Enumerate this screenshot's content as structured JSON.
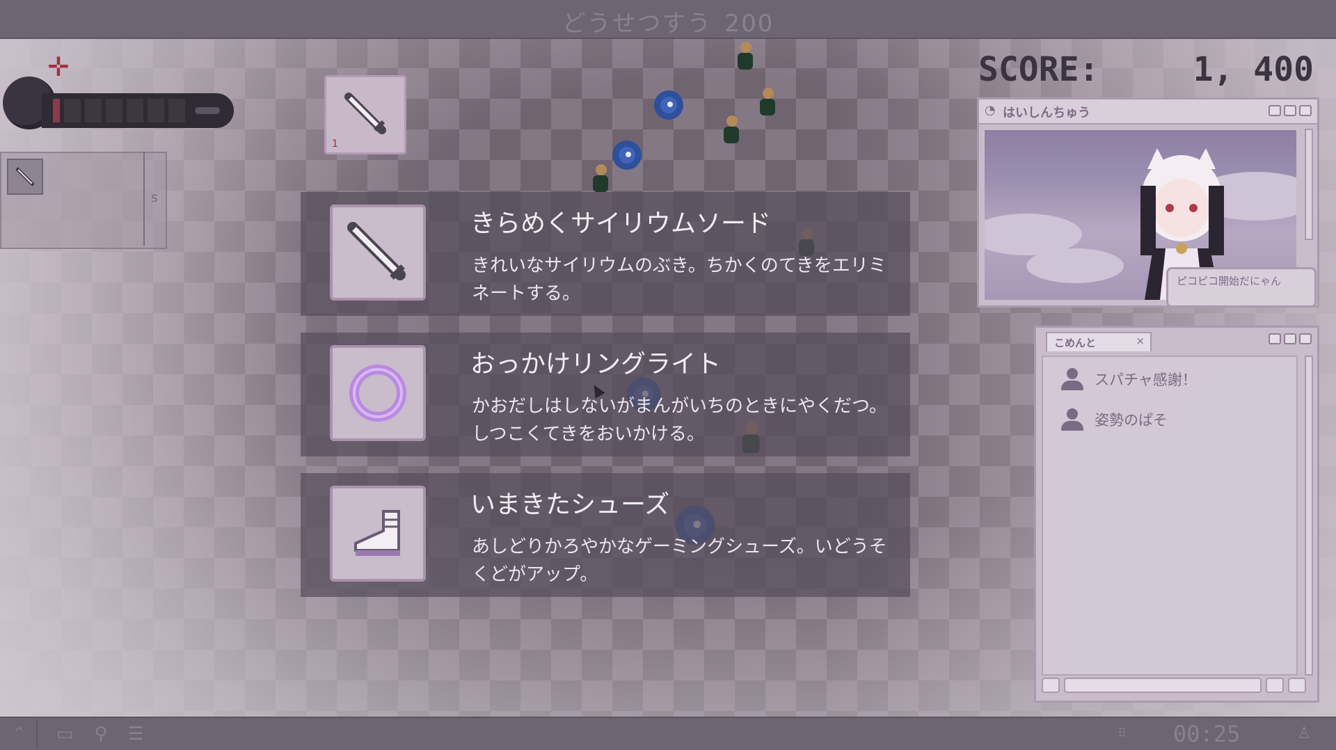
{
  "topbar": {
    "kills_label": "どうせつすう",
    "kills_value": "200"
  },
  "player": {
    "hp_segments_total": 8,
    "hp_filled": 1,
    "crosshair_icon": "crosshair-icon",
    "bomb_icon": "bomb-icon"
  },
  "inventory": {
    "held_weapon_level": "1",
    "side_tab_label": "S"
  },
  "choices": [
    {
      "name": "きらめくサイリウムソード",
      "desc": "きれいなサイリウムのぶき。ちかくのてきをエリミネートする。",
      "icon": "sword-icon"
    },
    {
      "name": "おっかけリングライト",
      "desc": "かおだしはしないがまんがいちのときにやくだつ。しつこくてきをおいかける。",
      "icon": "ring-light-icon"
    },
    {
      "name": "いまきたシューズ",
      "desc": "あしどりかろやかなゲーミングシューズ。いどうそくどがアップ。",
      "icon": "shoe-icon"
    }
  ],
  "score": {
    "label": "SCORE:",
    "value": "1, 400"
  },
  "stream_window": {
    "title": "はいしんちゅう",
    "bubble": "ピコピコ開始だにゃん"
  },
  "comments_window": {
    "tab_label": "こめんと",
    "tab_close": "×",
    "comments": [
      {
        "text": "スパチャ感謝！"
      },
      {
        "text": "姿勢のぱそ"
      }
    ]
  },
  "taskbar": {
    "caret": "^",
    "time": "00:25",
    "grip": "⠿",
    "user_icon": "person-icon"
  },
  "colors": {
    "accent": "#a993ad",
    "card_bg": "#584e5c",
    "score_text": "#3b3440",
    "hp_fill": "#8b3a4c"
  }
}
